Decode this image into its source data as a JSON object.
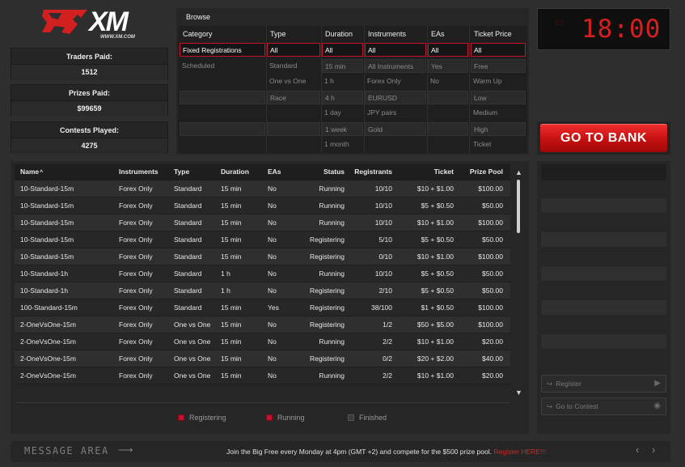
{
  "logo": {
    "text": "XM",
    "url": "WWW.XM.COM"
  },
  "stats": [
    {
      "label": "Traders Paid:",
      "value": "1512"
    },
    {
      "label": "Prizes Paid:",
      "value": "$99659"
    },
    {
      "label": "Contests Played:",
      "value": "4275"
    }
  ],
  "browse": {
    "tab_label": "Browse",
    "columns": [
      {
        "header": "Category",
        "options": [
          "Fixed Registrations",
          "Scheduled",
          "",
          "",
          ""
        ],
        "selected": 0
      },
      {
        "header": "Type",
        "options": [
          "All",
          "Standard",
          "One vs One",
          "Race",
          ""
        ],
        "selected": 0
      },
      {
        "header": "Duration",
        "options": [
          "All",
          "15 min",
          "1 h",
          "4 h",
          "1 day",
          "1 week",
          "1 month"
        ],
        "selected": 0
      },
      {
        "header": "Instruments",
        "options": [
          "All",
          "All Instruments",
          "Forex Only",
          "EURUSD",
          "JPY pairs",
          "Gold"
        ],
        "selected": 0
      },
      {
        "header": "EAs",
        "options": [
          "All",
          "Yes",
          "No",
          "",
          ""
        ],
        "selected": 0
      },
      {
        "header": "Ticket Price",
        "options": [
          "All",
          "Free",
          "Warm Up",
          "Low",
          "Medium",
          "High",
          "Ticket"
        ],
        "selected": 0
      }
    ]
  },
  "clock": {
    "ghost": "ET",
    "time": "18:00"
  },
  "bank_button": "GO TO BANK",
  "table": {
    "headers": [
      "Name",
      "Instruments",
      "Type",
      "Duration",
      "EAs",
      "Status",
      "Registrants",
      "Ticket",
      "Prize Pool"
    ],
    "sort_indicator": "^",
    "rows": [
      [
        "10-Standard-15m",
        "Forex Only",
        "Standard",
        "15 min",
        "No",
        "Running",
        "10/10",
        "$10 + $1.00",
        "$100.00"
      ],
      [
        "10-Standard-15m",
        "Forex Only",
        "Standard",
        "15 min",
        "No",
        "Running",
        "10/10",
        "$5 + $0.50",
        "$50.00"
      ],
      [
        "10-Standard-15m",
        "Forex Only",
        "Standard",
        "15 min",
        "No",
        "Running",
        "10/10",
        "$10 + $1.00",
        "$100.00"
      ],
      [
        "10-Standard-15m",
        "Forex Only",
        "Standard",
        "15 min",
        "No",
        "Registering",
        "5/10",
        "$5 + $0.50",
        "$50.00"
      ],
      [
        "10-Standard-15m",
        "Forex Only",
        "Standard",
        "15 min",
        "No",
        "Registering",
        "0/10",
        "$10 + $1.00",
        "$100.00"
      ],
      [
        "10-Standard-1h",
        "Forex Only",
        "Standard",
        "1 h",
        "No",
        "Running",
        "10/10",
        "$5 + $0.50",
        "$50.00"
      ],
      [
        "10-Standard-1h",
        "Forex Only",
        "Standard",
        "1 h",
        "No",
        "Registering",
        "2/10",
        "$5 + $0.50",
        "$50.00"
      ],
      [
        "100-Standard-15m",
        "Forex Only",
        "Standard",
        "15 min",
        "Yes",
        "Registering",
        "38/100",
        "$1 + $0.50",
        "$100.00"
      ],
      [
        "2-OneVsOne-15m",
        "Forex Only",
        "One vs One",
        "15 min",
        "No",
        "Registering",
        "1/2",
        "$50 + $5.00",
        "$100.00"
      ],
      [
        "2-OneVsOne-15m",
        "Forex Only",
        "One vs One",
        "15 min",
        "No",
        "Running",
        "2/2",
        "$10 + $1.00",
        "$20.00"
      ],
      [
        "2-OneVsOne-15m",
        "Forex Only",
        "One vs One",
        "15 min",
        "No",
        "Registering",
        "0/2",
        "$20 + $2.00",
        "$40.00"
      ],
      [
        "2-OneVsOne-15m",
        "Forex Only",
        "One vs One",
        "15 min",
        "No",
        "Running",
        "2/2",
        "$10 + $1.00",
        "$20.00"
      ]
    ]
  },
  "legend": [
    {
      "label": "Registering",
      "color": "#c8102e"
    },
    {
      "label": "Running",
      "color": "#c8102e"
    },
    {
      "label": "Finished",
      "color": "#3a3a3a"
    }
  ],
  "side": {
    "register_label": "Register",
    "go_to_contest_label": "Go to Contest"
  },
  "message": {
    "label": "MESSAGE AREA",
    "text": "Join the Big Free every Monday at 4pm (GMT +2) and compete for the $500 prize pool.",
    "link": "Register HERE!!!"
  },
  "icons": {
    "arrow_right": "⟶",
    "scroll_up": "▲",
    "scroll_down": "▼",
    "nav": "‹ ›",
    "register_icon": "↪",
    "play_icon": "▶",
    "eye_icon": "◉"
  }
}
